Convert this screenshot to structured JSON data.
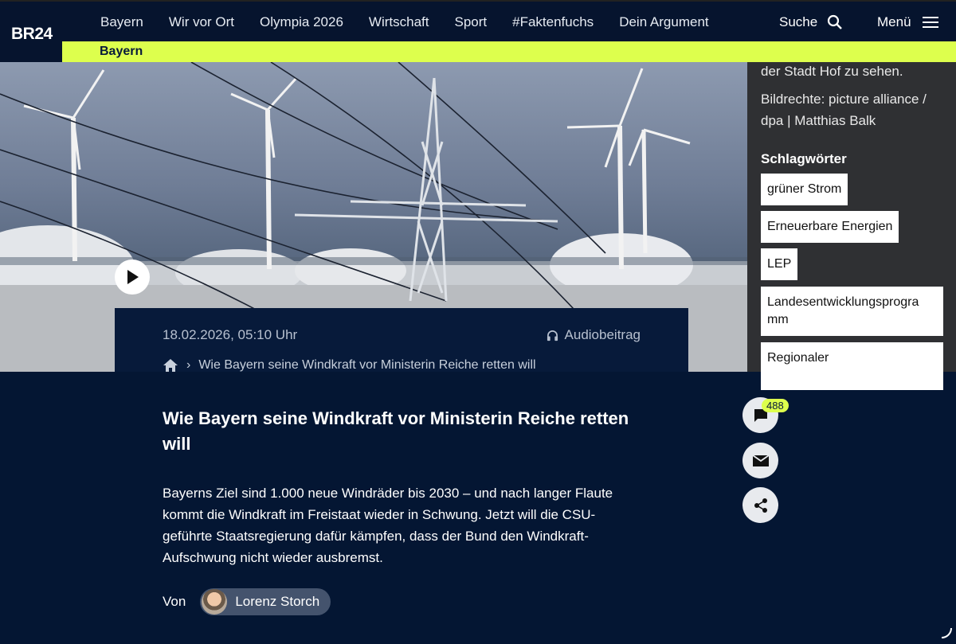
{
  "logo": "BR24",
  "nav": {
    "items": [
      "Bayern",
      "Wir vor Ort",
      "Olympia 2026",
      "Wirtschaft",
      "Sport",
      "#Faktenfuchs",
      "Dein Argument"
    ],
    "search_label": "Suche",
    "menu_label": "Menü"
  },
  "section_bar": {
    "label": "Bayern"
  },
  "image_sidebar": {
    "caption": "der Stadt Hof zu sehen.",
    "credits": "Bildrechte: picture alliance / dpa | Matthias Balk",
    "tags_title": "Schlagwörter",
    "tags": [
      "grüner Strom",
      "Erneuerbare Energien",
      "LEP",
      "Landesentwicklungsprogra mm",
      "Regionaler"
    ]
  },
  "meta": {
    "date": "18.02.2026, 05:10 Uhr",
    "audio_label": "Audiobeitrag",
    "breadcrumb_current": "Wie Bayern seine Windkraft vor Ministerin Reiche retten will"
  },
  "article": {
    "title": "Wie Bayern seine Windkraft vor Ministerin Reiche retten will",
    "lead": "Bayerns Ziel sind 1.000 neue Windräder bis 2030 – und nach langer Flaute kommt die Windkraft im Freistaat wieder in Schwung. Jetzt will die CSU-geführte Staatsregierung dafür kämpfen, dass der Bund den Windkraft-Aufschwung nicht wieder ausbremst.",
    "by_label": "Von",
    "author": "Lorenz Storch"
  },
  "actions": {
    "comment_count": "488"
  },
  "colors": {
    "navy": "#041633",
    "accent": "#ddff4d"
  }
}
